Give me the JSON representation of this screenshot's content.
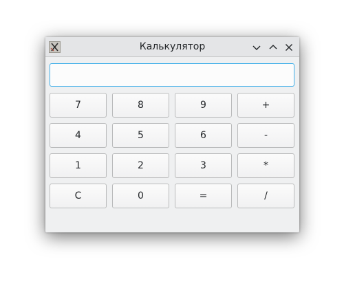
{
  "window": {
    "title": "Калькулятор"
  },
  "display": {
    "value": ""
  },
  "keypad": {
    "rows": [
      [
        "7",
        "8",
        "9",
        "+"
      ],
      [
        "4",
        "5",
        "6",
        "-"
      ],
      [
        "1",
        "2",
        "3",
        "*"
      ],
      [
        "C",
        "0",
        "=",
        "/"
      ]
    ]
  },
  "titlebar_icons": [
    "app-icon",
    "minimize-icon",
    "maximize-icon",
    "close-icon"
  ],
  "colors": {
    "window_bg": "#eff0f1",
    "focus_border": "#3daee9",
    "text": "#232629"
  }
}
